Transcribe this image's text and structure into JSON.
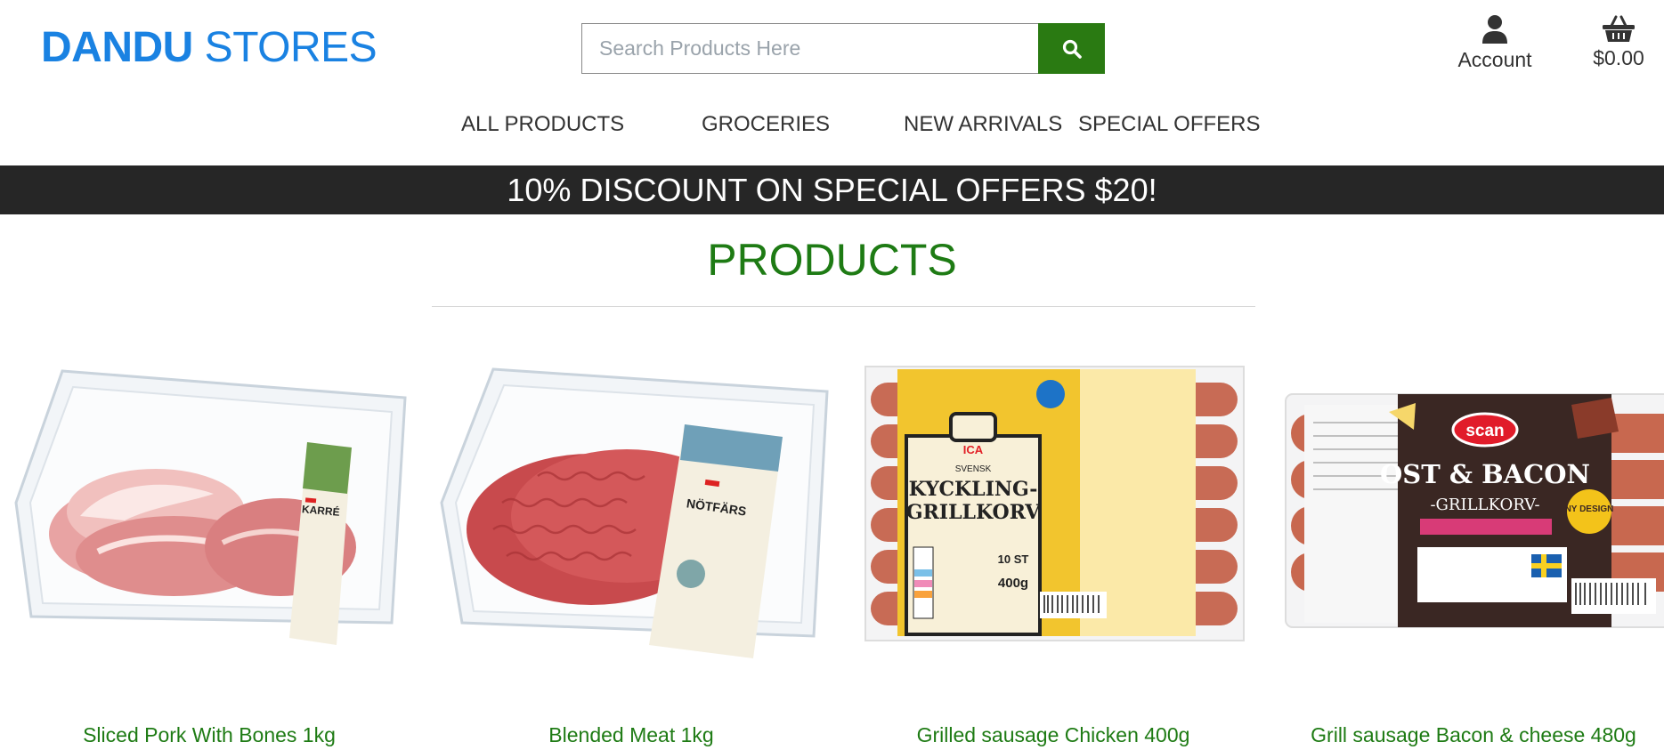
{
  "header": {
    "logo_part1": "DANDU",
    "logo_part2": "STORES",
    "search_placeholder": "Search Products Here",
    "search_icon": "search-icon",
    "account_label": "Account",
    "account_icon": "user-icon",
    "cart_total": "$0.00",
    "cart_icon": "basket-icon"
  },
  "nav": {
    "items": [
      {
        "label": "ALL PRODUCTS"
      },
      {
        "label": "GROCERIES"
      },
      {
        "label": "NEW ARRIVALS"
      },
      {
        "label": "SPECIAL OFFERS"
      }
    ]
  },
  "banner": {
    "text": "10% DISCOUNT ON SPECIAL OFFERS $20!"
  },
  "products": {
    "title": "PRODUCTS",
    "items": [
      {
        "name": "Sliced Pork With Bones 1kg",
        "image_icon": "pork-tray-image"
      },
      {
        "name": "Blended Meat 1kg",
        "image_icon": "minced-meat-tray-image"
      },
      {
        "name": "Grilled sausage Chicken 400g",
        "image_icon": "chicken-sausage-pack-image",
        "label_brand": "ICA",
        "label_top": "SVENSK",
        "label_main1": "KYCKLING-",
        "label_main2": "GRILLKORV",
        "label_weight": "400g",
        "label_count": "10 ST"
      },
      {
        "name": "Grill sausage Bacon & cheese 480g",
        "image_icon": "bacon-cheese-sausage-pack-image",
        "label_brand": "scan",
        "label_main1": "OST & BACON",
        "label_main2": "-GRILLKORV-",
        "label_badge": "NY DESIGN"
      }
    ]
  },
  "colors": {
    "brand_blue": "#1a82e2",
    "accent_green": "#2a7a12",
    "product_green": "#1e7b14",
    "banner_bg": "#262626"
  }
}
